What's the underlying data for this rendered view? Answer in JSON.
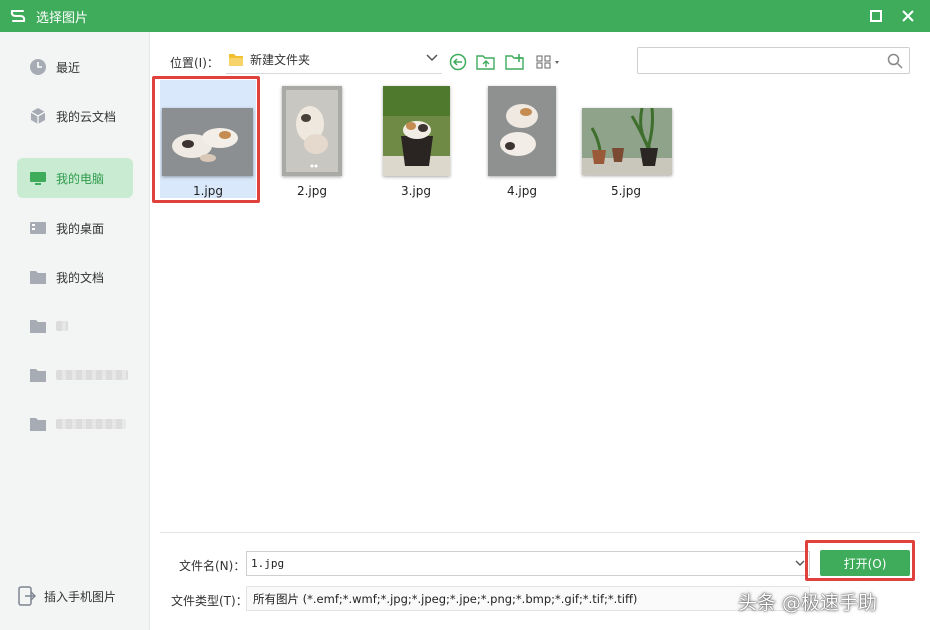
{
  "window": {
    "title": "选择图片",
    "brand_color": "#3fac5c",
    "icons": {
      "logo": "wps-s-logo",
      "maximize": "maximize-icon",
      "close": "close-icon"
    }
  },
  "sidebar": {
    "items": [
      {
        "label": "最近",
        "icon": "clock-icon",
        "active": false
      },
      {
        "label": "我的云文档",
        "icon": "cloud-cube-icon",
        "active": false
      },
      {
        "label": "我的电脑",
        "icon": "monitor-icon",
        "active": true
      },
      {
        "label": "我的桌面",
        "icon": "desktop-icon",
        "active": false
      },
      {
        "label": "我的文档",
        "icon": "folder-icon",
        "active": false
      }
    ],
    "insert_phone_label": "插入手机图片"
  },
  "toolbar": {
    "location_label": "位置(I)：",
    "current_path": "新建文件夹",
    "icons": [
      "back-icon",
      "up-folder-icon",
      "new-folder-icon",
      "view-mode-icon"
    ]
  },
  "search": {
    "placeholder": "",
    "value": ""
  },
  "files": [
    {
      "name": "1.jpg",
      "selected": true
    },
    {
      "name": "2.jpg",
      "selected": false
    },
    {
      "name": "3.jpg",
      "selected": false
    },
    {
      "name": "4.jpg",
      "selected": false
    },
    {
      "name": "5.jpg",
      "selected": false
    }
  ],
  "bottom": {
    "filename_label": "文件名(N)：",
    "filename_value": "1.jpg",
    "filetype_label": "文件类型(T)：",
    "filetype_value": "所有图片 (*.emf;*.wmf;*.jpg;*.jpeg;*.jpe;*.png;*.bmp;*.gif;*.tif;*.tiff)",
    "open_button_label": "打开(O)"
  },
  "watermark": "头条 @极速手助",
  "colors": {
    "highlight_frame": "#e0413d",
    "active_sidebar_bg": "#c9ebd2",
    "active_sidebar_text": "#2e9b4c"
  }
}
